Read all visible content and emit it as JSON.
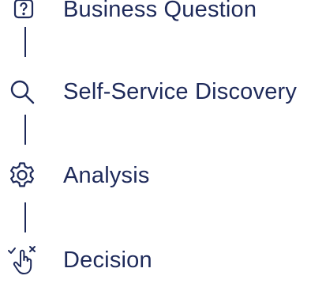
{
  "steps": [
    {
      "label": "Business Question",
      "icon": "question-box-icon"
    },
    {
      "label": "Self-Service Discovery",
      "icon": "search-icon"
    },
    {
      "label": "Analysis",
      "icon": "gear-icon"
    },
    {
      "label": "Decision",
      "icon": "hand-choice-icon"
    }
  ],
  "colors": {
    "ink": "#1e2a5a",
    "background": "#ffffff"
  }
}
